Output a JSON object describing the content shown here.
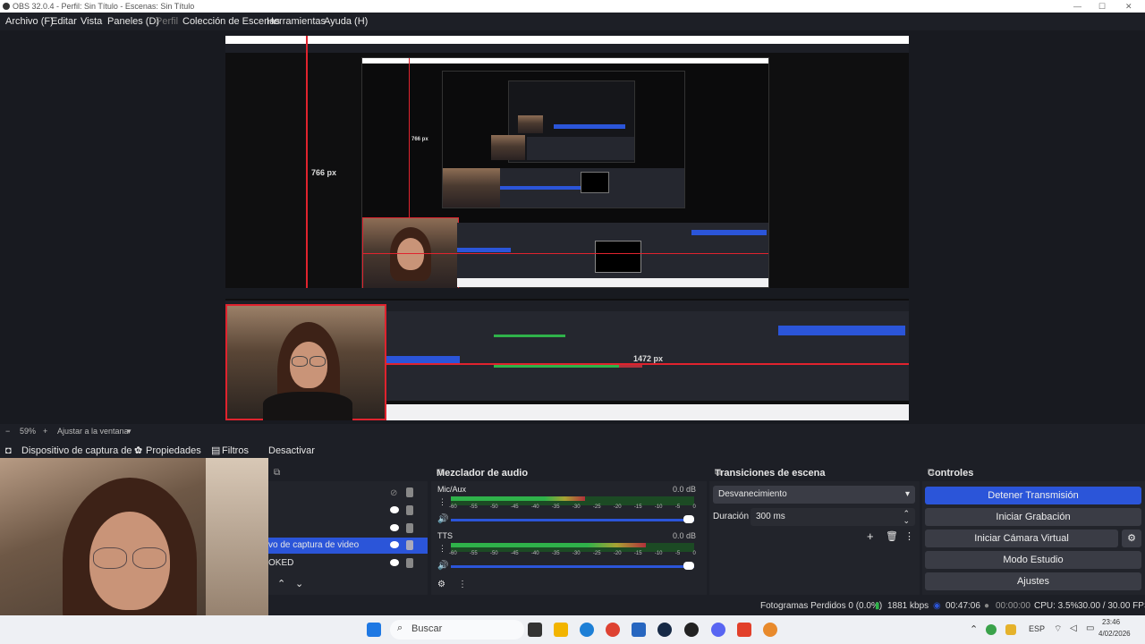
{
  "window": {
    "title": "OBS 32.0.4 - Perfil: Sin Título - Escenas: Sin Título",
    "controls": [
      "—",
      "☐",
      "✕"
    ]
  },
  "menu": [
    {
      "label": "Archivo (F)",
      "dim": false
    },
    {
      "label": "Editar",
      "dim": false
    },
    {
      "label": "Vista",
      "dim": false
    },
    {
      "label": "Paneles (D)",
      "dim": false
    },
    {
      "label": "Perfil",
      "dim": true
    },
    {
      "label": "Colección de Escenas",
      "dim": false
    },
    {
      "label": "Herramientas",
      "dim": false
    },
    {
      "label": "Ayuda (H)",
      "dim": false
    }
  ],
  "preview": {
    "measure_v": "766 px",
    "measure_v2": "766 px",
    "measure_h": "1472 px",
    "zoom": "59%",
    "fit_label": "Ajustar a la ventana"
  },
  "source_toolbar": {
    "source": "Dispositivo de captura de v",
    "properties": "Propiedades",
    "filters": "Filtros",
    "deactivate": "Desactivar"
  },
  "sources_dock": {
    "items": [
      "Dispositivo de captura de video",
      "KED"
    ],
    "selected_label": "vo de captura de video",
    "bottom_label": "OKED"
  },
  "mixer": {
    "title": "Mezclador de audio",
    "tracks": [
      {
        "name": "Mic/Aux",
        "db": "0.0 dB",
        "level": 0.55
      },
      {
        "name": "TTS",
        "db": "0.0 dB",
        "level": 0.8
      }
    ],
    "scale": [
      "-60",
      "-55",
      "-50",
      "-45",
      "-40",
      "-35",
      "-30",
      "-25",
      "-20",
      "-15",
      "-10",
      "-5",
      "0"
    ]
  },
  "transitions": {
    "title": "Transiciones de escena",
    "selected": "Desvanecimiento",
    "duration_label": "Duración",
    "duration_value": "300 ms"
  },
  "controls": {
    "title": "Controles",
    "buttons": [
      "Detener Transmisión",
      "Iniciar Grabación",
      "Iniciar Cámara Virtual",
      "Modo Estudio",
      "Ajustes"
    ]
  },
  "status": {
    "dropped": "Fotogramas Perdidos 0 (0.0%)",
    "bitrate": "1881 kbps",
    "stream_time": "00:47:06",
    "rec_time": "00:00:00",
    "cpu": "CPU: 3.5%",
    "fps": "30.00 / 30.00 FPS"
  },
  "taskbar": {
    "search": "Buscar",
    "lang": "ESP",
    "time": "23:46",
    "date": "4/02/2026"
  },
  "colors": {
    "accent": "#2b55d9",
    "red": "#e0232e",
    "meter_green": "#2fb24a",
    "meter_yellow": "#a8a233",
    "meter_red": "#b1313b"
  }
}
